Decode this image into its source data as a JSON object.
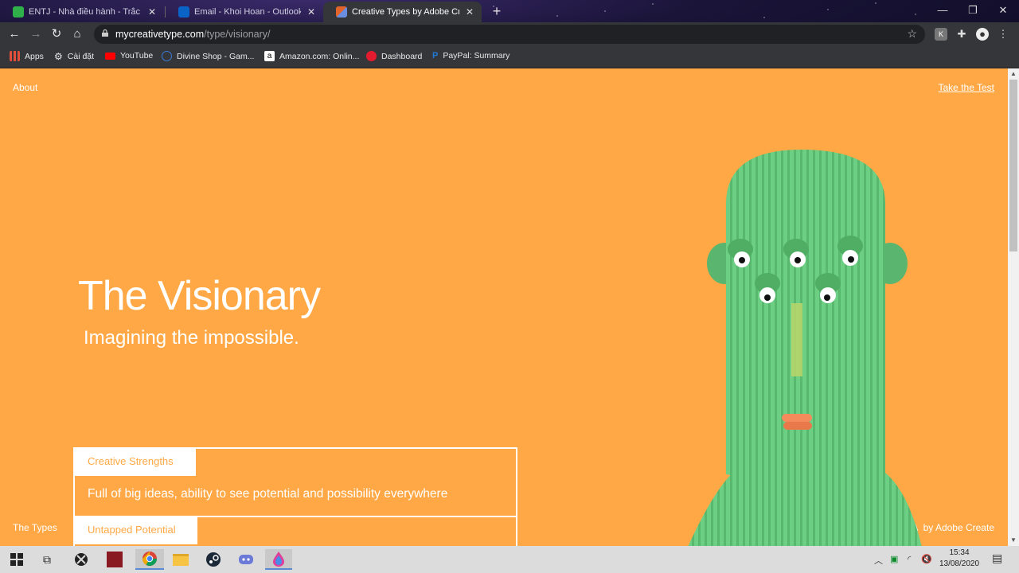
{
  "browser": {
    "tabs": [
      {
        "title": "ENTJ - Nhà điều hành - Trắc nghiệm",
        "active": false,
        "favicon_color": "#2fb04a"
      },
      {
        "title": "Email - Khoi Hoan - Outlook",
        "active": false,
        "favicon_color": "#0a64c8"
      },
      {
        "title": "Creative Types by Adobe Create",
        "active": true,
        "favicon_color": "#e2642a"
      }
    ],
    "new_tab": "+",
    "url_domain": "mycreativetype.com",
    "url_path": "/type/visionary/",
    "bookmarks": [
      {
        "label": "Apps",
        "icon": "apps-grid-icon",
        "color": "#e34f3b"
      },
      {
        "label": "Cài đặt",
        "icon": "gear-icon",
        "color": "#ddd"
      },
      {
        "label": "YouTube",
        "icon": "youtube-icon",
        "color": "#ff0000"
      },
      {
        "label": "Divine Shop - Gam...",
        "icon": "divine-shop-icon",
        "color": "#3a7bd5"
      },
      {
        "label": "Amazon.com: Onlin...",
        "icon": "amazon-icon",
        "color": "#ffffff"
      },
      {
        "label": "Dashboard",
        "icon": "dashboard-icon",
        "color": "#e41b2f"
      },
      {
        "label": "PayPal: Summary",
        "icon": "paypal-icon",
        "color": "#1f7ad6"
      }
    ]
  },
  "page": {
    "background": "#ffa845",
    "nav_about": "About",
    "nav_take_test": "Take the Test",
    "title": "The Visionary",
    "subtitle": "Imagining the impossible.",
    "strengths_label": "Creative Strengths",
    "strengths_body": "Full of big ideas, ability to see potential and possibility everywhere",
    "potential_label": "Untapped Potential",
    "footer_types": "The Types",
    "footer_brand": "by Adobe Create"
  },
  "taskbar": {
    "time": "15:34",
    "date": "13/08/2020"
  }
}
